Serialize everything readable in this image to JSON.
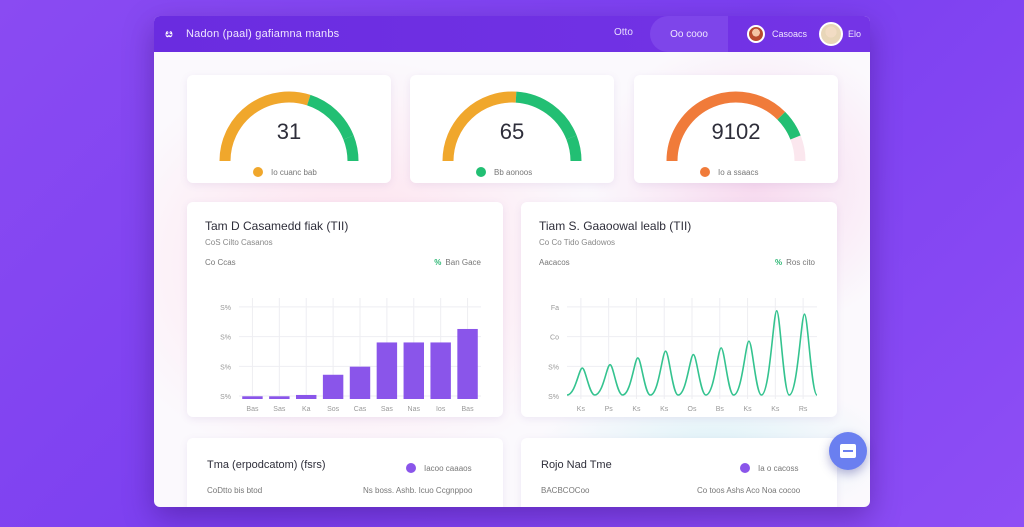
{
  "header": {
    "logo": "ೞ",
    "title": "Nadon (paal) gafiamna manbs",
    "nav_link": "Otto",
    "nav_pill": "Oo cooo",
    "user1": "Casoacs",
    "user2": "Elo"
  },
  "gauges": [
    {
      "value": "31",
      "legend": "Io cuanc bab",
      "fraction": 0.6,
      "dot_color": "#f0a72c",
      "start_color": "#f0a72c",
      "end_color": "#22bf73"
    },
    {
      "value": "65",
      "legend": "Bb aonoos",
      "fraction": 0.52,
      "dot_color": "#22bf73",
      "start_color": "#f0a72c",
      "end_color": "#22bf73"
    },
    {
      "value": "9102",
      "legend": "Io a ssaacs",
      "fraction": 0.75,
      "dot_color": "#f07b3a",
      "start_color": "#f07b3a",
      "end_color": "#22bf73"
    }
  ],
  "bar_panel": {
    "title": "Tam D Casamedd fiak (TII)",
    "subtitle": "CoS Cilto Casanos",
    "series_label": "Co Ccas",
    "legend_mark": "%",
    "legend_text": "Ban Gace"
  },
  "line_panel": {
    "title": "Tiam S. Gaaoowal lealb (TII)",
    "subtitle": "Co Co Tido Gadowos",
    "series_label": "Aacacos",
    "legend_mark": "%",
    "legend_text": "Ros cito"
  },
  "chart_data": [
    {
      "type": "bar",
      "color": "#8a55ea",
      "yticks": [
        "S%",
        "S%",
        "S%",
        "S%"
      ],
      "categories": [
        "Bas",
        "Sas",
        "Ka",
        "Sos",
        "Cas",
        "Sas",
        "Nas",
        "Ios",
        "Bas"
      ],
      "values": [
        2,
        2,
        3,
        18,
        24,
        42,
        42,
        42,
        52
      ],
      "ylim": [
        0,
        75
      ]
    },
    {
      "type": "line",
      "color": "#34c38f",
      "yticks": [
        "S%",
        "S%",
        "Co",
        "Fa"
      ],
      "categories": [
        "Ks",
        "Ps",
        "Ks",
        "Ks",
        "Os",
        "Bs",
        "Ks",
        "Ks",
        "Rs"
      ],
      "peaks": [
        16,
        18,
        22,
        26,
        24,
        28,
        32,
        50,
        48
      ],
      "ylim": [
        0,
        60
      ]
    }
  ],
  "bottom_left": {
    "title": "Tma (erpodcatom) (fsrs)",
    "legend": "Iacoo caaaos",
    "sub_left": "CoDtto bis btod",
    "sub_right": "Ns boss. Ashb. Icuo Ccgnppoo"
  },
  "bottom_right": {
    "title": "Rojo Nad Tme",
    "legend": "Ia o cacoss",
    "sub_left": "BACBCOCoo",
    "sub_right": "Co toos Ashs Aco Noa cocoo"
  }
}
